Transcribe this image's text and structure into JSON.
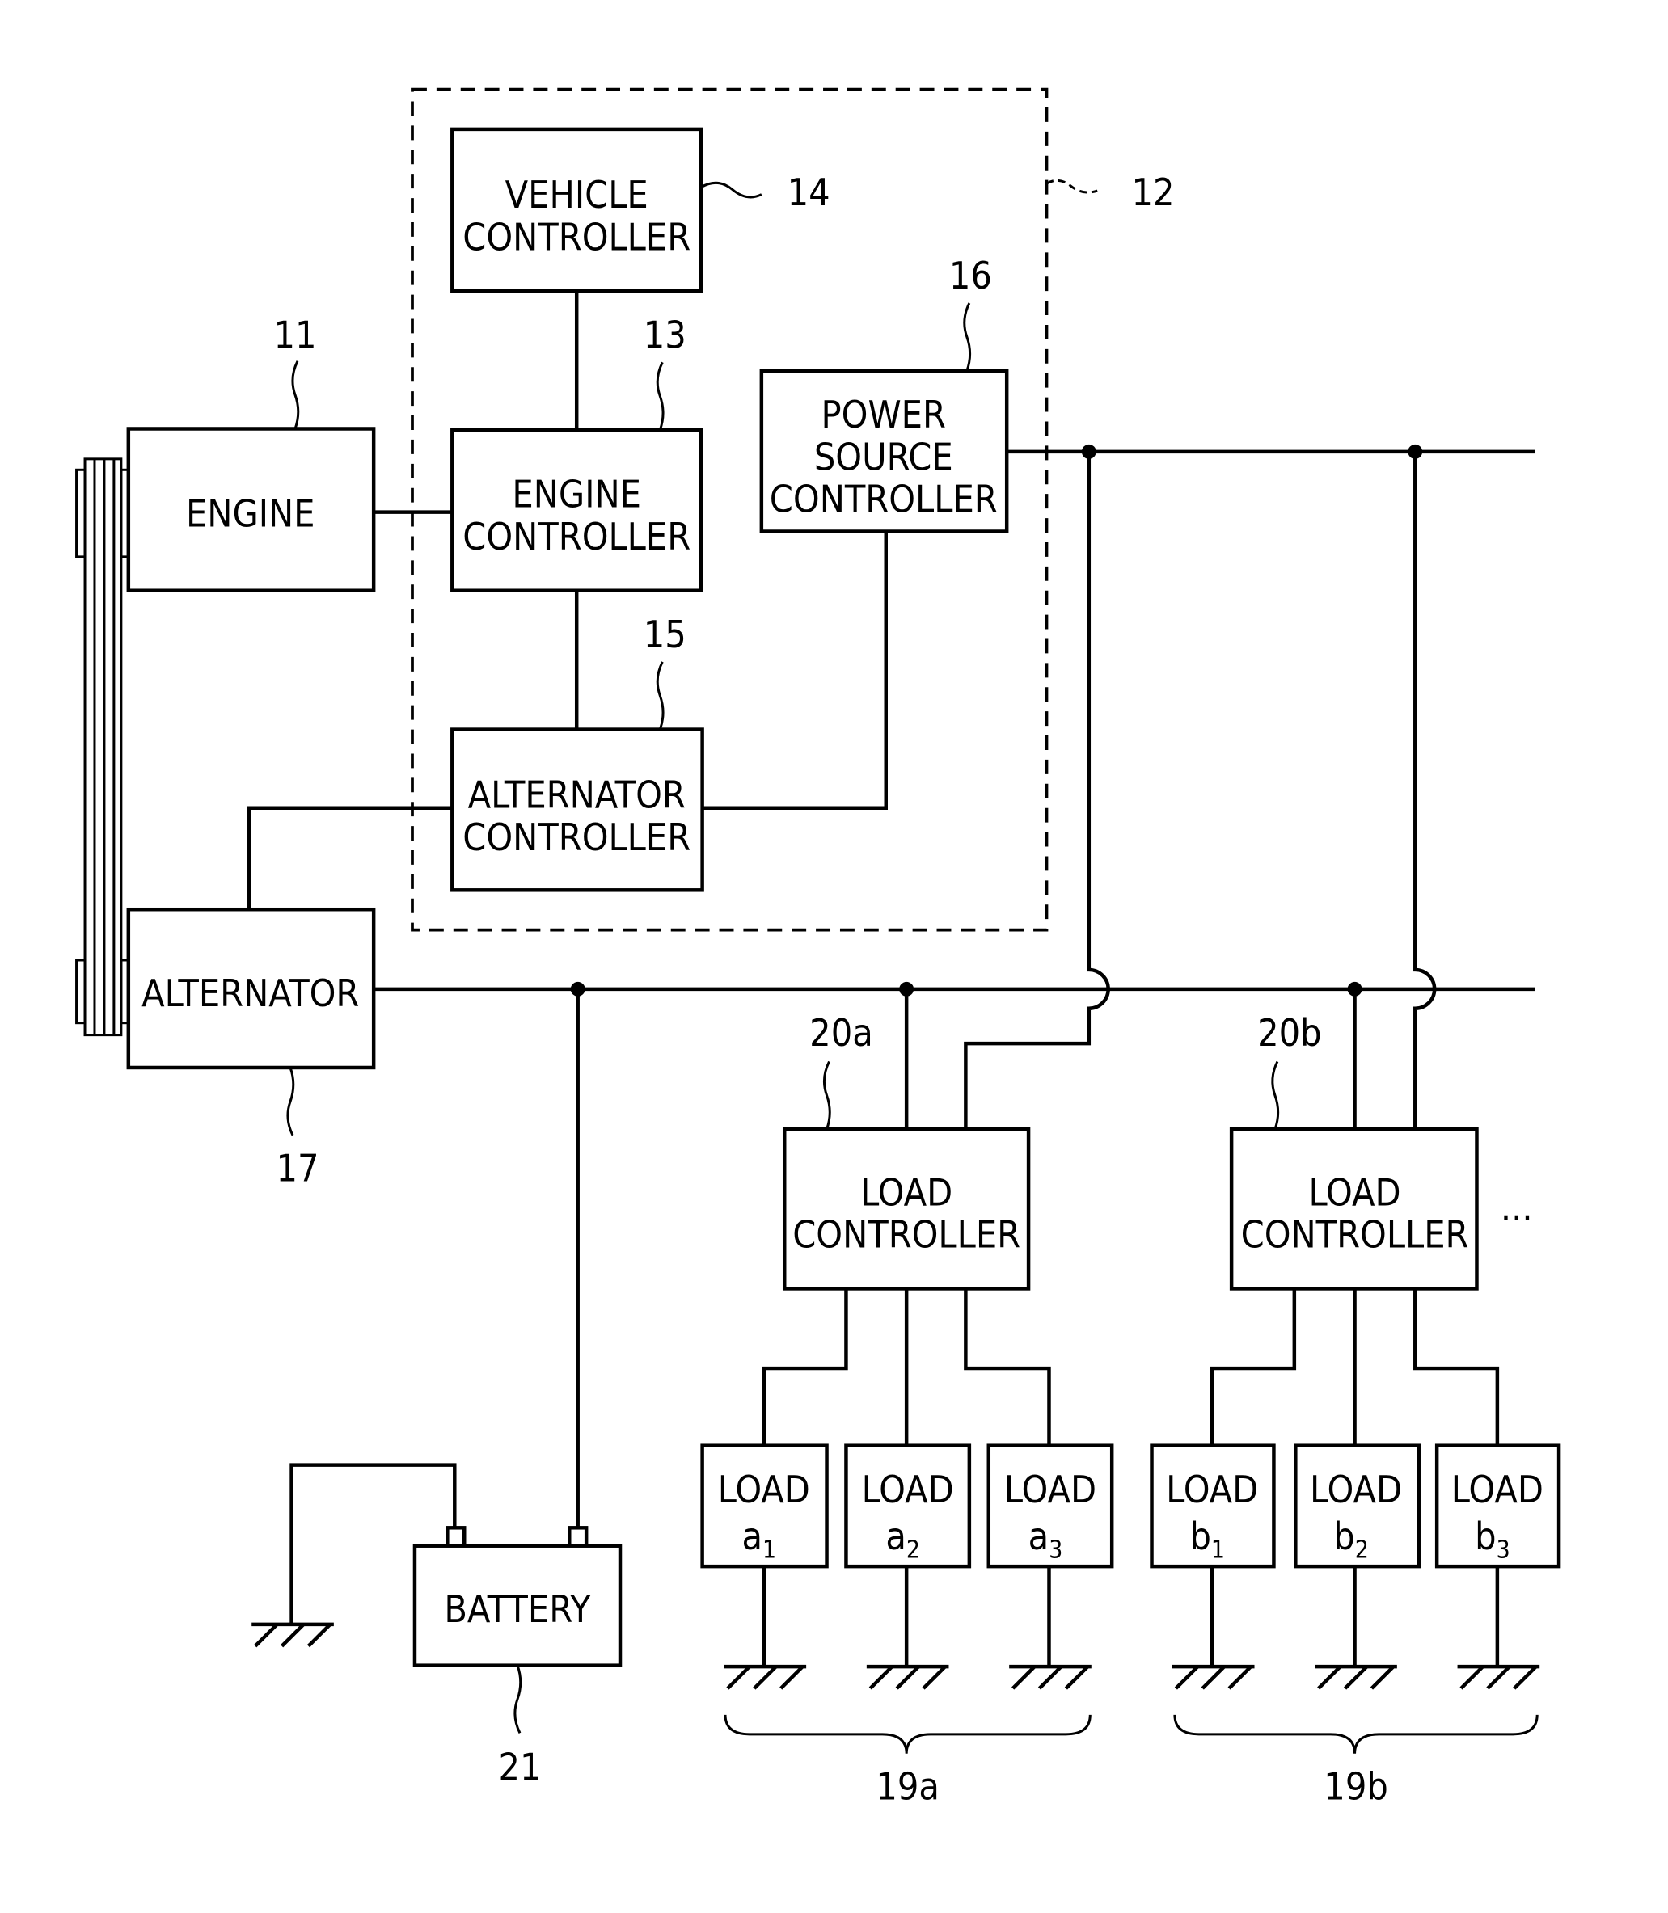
{
  "diagram": {
    "blocks": {
      "vehicle_controller": {
        "ref": "14",
        "lines": [
          "VEHICLE",
          "CONTROLLER"
        ]
      },
      "engine": {
        "ref": "11",
        "lines": [
          "ENGINE"
        ]
      },
      "engine_controller": {
        "ref": "13",
        "lines": [
          "ENGINE",
          "CONTROLLER"
        ]
      },
      "power_source_controller": {
        "ref": "16",
        "lines": [
          "POWER",
          "SOURCE",
          "CONTROLLER"
        ]
      },
      "alternator_controller": {
        "ref": "15",
        "lines": [
          "ALTERNATOR",
          "CONTROLLER"
        ]
      },
      "alternator": {
        "ref": "17",
        "lines": [
          "ALTERNATOR"
        ]
      },
      "battery": {
        "ref": "21",
        "lines": [
          "BATTERY"
        ]
      },
      "load_controller_a": {
        "ref": "20a",
        "lines": [
          "LOAD",
          "CONTROLLER"
        ]
      },
      "load_controller_b": {
        "ref": "20b",
        "lines": [
          "LOAD",
          "CONTROLLER"
        ]
      }
    },
    "control_unit_ref": "12",
    "loads_a": {
      "group_ref": "19a",
      "items": [
        {
          "label": "LOAD",
          "letter": "a",
          "index": "1"
        },
        {
          "label": "LOAD",
          "letter": "a",
          "index": "2"
        },
        {
          "label": "LOAD",
          "letter": "a",
          "index": "3"
        }
      ]
    },
    "loads_b": {
      "group_ref": "19b",
      "items": [
        {
          "label": "LOAD",
          "letter": "b",
          "index": "1"
        },
        {
          "label": "LOAD",
          "letter": "b",
          "index": "2"
        },
        {
          "label": "LOAD",
          "letter": "b",
          "index": "3"
        }
      ]
    },
    "continuation": "..."
  }
}
